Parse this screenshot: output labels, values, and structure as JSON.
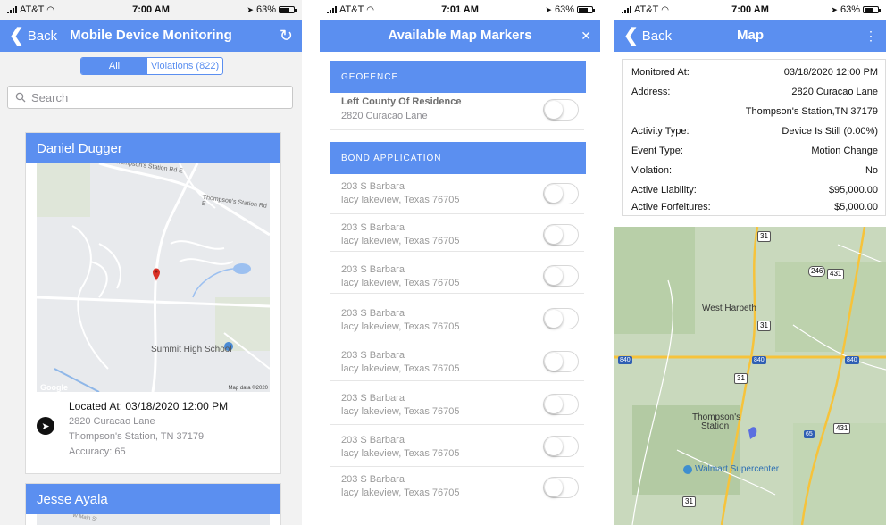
{
  "screens": {
    "monitoring": {
      "status": {
        "carrier": "AT&T",
        "time": "7:00 AM",
        "battery": "63%"
      },
      "nav": {
        "back_label": "Back",
        "title": "Mobile Device Monitoring",
        "refresh_icon": "refresh-icon"
      },
      "filter": {
        "all_label": "All",
        "violations_label": "Violations (822)",
        "selected": "All"
      },
      "search": {
        "placeholder": "Search"
      },
      "cards": [
        {
          "name": "Daniel Dugger",
          "map": {
            "roads": [
              "Thompson's Station Rd E",
              "Thompson's Station Rd E"
            ],
            "poi": "Summit High School",
            "provider": "Google",
            "attribution": "Map data ©2020"
          },
          "located_at": "Located At: 03/18/2020 12:00 PM",
          "address1": "2820 Curacao Lane",
          "address2": "Thompson's Station, TN 37179",
          "accuracy": "Accuracy: 65"
        },
        {
          "name": "Jesse Ayala",
          "map": {
            "roads": [
              "W Main St"
            ]
          }
        }
      ],
      "accent_color": "#5b8ff0"
    },
    "markers": {
      "status": {
        "carrier": "AT&T",
        "time": "7:01 AM",
        "battery": "63%"
      },
      "nav": {
        "title": "Available Map Markers",
        "close_icon": "close-icon"
      },
      "sections": [
        {
          "header": "GEOFENCE",
          "items": [
            {
              "line1": "Left County Of Residence",
              "line2": "2820 Curacao Lane",
              "enabled": false
            }
          ]
        },
        {
          "header": "BOND APPLICATION",
          "items": [
            {
              "line1": "203 S Barbara",
              "line2": "lacy lakeview, Texas 76705",
              "enabled": false
            },
            {
              "line1": "203 S Barbara",
              "line2": "lacy lakeview, Texas 76705",
              "enabled": false
            },
            {
              "line1": "203 S Barbara",
              "line2": "lacy lakeview, Texas 76705",
              "enabled": false
            },
            {
              "line1": "203 S Barbara",
              "line2": "lacy lakeview, Texas 76705",
              "enabled": false
            },
            {
              "line1": "203 S Barbara",
              "line2": "lacy lakeview, Texas 76705",
              "enabled": false
            },
            {
              "line1": "203 S Barbara",
              "line2": "lacy lakeview, Texas 76705",
              "enabled": false
            },
            {
              "line1": "203 S Barbara",
              "line2": "lacy lakeview, Texas 76705",
              "enabled": false
            },
            {
              "line1": "203 S Barbara",
              "line2": "lacy lakeview, Texas 76705",
              "enabled": false
            }
          ]
        }
      ]
    },
    "map": {
      "status": {
        "carrier": "AT&T",
        "time": "7:00 AM",
        "battery": "63%"
      },
      "nav": {
        "back_label": "Back",
        "title": "Map",
        "menu_icon": "menu-icon"
      },
      "details": [
        {
          "key": "Monitored At:",
          "value": "03/18/2020 12:00 PM"
        },
        {
          "key": "Address:",
          "value": "2820 Curacao Lane"
        },
        {
          "key": "",
          "value": "Thompson's Station,TN 37179"
        },
        {
          "key": "Activity Type:",
          "value": "Device Is Still (0.00%)"
        },
        {
          "key": "Event Type:",
          "value": "Motion Change"
        },
        {
          "key": "Violation:",
          "value": "No"
        },
        {
          "key": "Active Liability:",
          "value": "$95,000.00"
        },
        {
          "key": "Active Forfeitures:",
          "value": "$5,000.00"
        }
      ],
      "map_labels": {
        "west_harpeth": "West Harpeth",
        "thompsons_station_1": "Thompson's",
        "thompsons_station_2": "Station",
        "walmart": "Walmart Supercenter",
        "shields": [
          "31",
          "246",
          "431",
          "31",
          "840",
          "840",
          "840",
          "31",
          "65",
          "431",
          "31"
        ]
      }
    }
  }
}
